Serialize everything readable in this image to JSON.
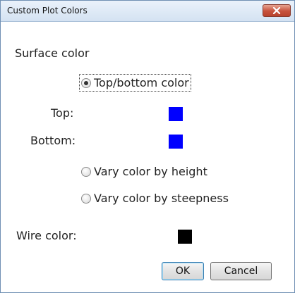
{
  "dialog": {
    "title": "Custom Plot Colors"
  },
  "surface": {
    "heading": "Surface color",
    "options": [
      {
        "label": "Top/bottom color",
        "selected": true
      },
      {
        "label": "Vary color by height",
        "selected": false
      },
      {
        "label": "Vary color by steepness",
        "selected": false
      }
    ],
    "top_label": "Top:",
    "top_color": "#0000ff",
    "bottom_label": "Bottom:",
    "bottom_color": "#0000ff"
  },
  "wire": {
    "label": "Wire color:",
    "color": "#000000"
  },
  "buttons": {
    "ok_label": "OK",
    "cancel_label": "Cancel"
  }
}
